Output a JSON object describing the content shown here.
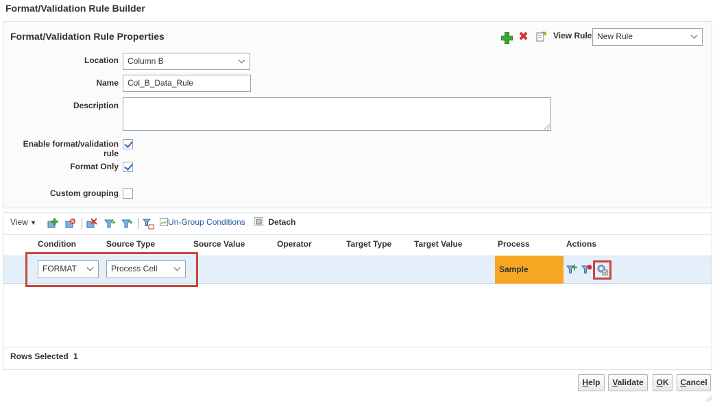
{
  "page": {
    "title": "Format/Validation Rule Builder"
  },
  "properties": {
    "title": "Format/Validation Rule Properties",
    "view_rule_label": "View Rule",
    "view_rule_value": "New Rule",
    "location_label": "Location",
    "location_value": "Column B",
    "name_label": "Name",
    "name_value": "Col_B_Data_Rule",
    "description_label": "Description",
    "description_value": "",
    "enable_label": "Enable format/validation rule",
    "enable_checked": true,
    "format_only_label": "Format Only",
    "format_only_checked": true,
    "custom_grouping_label": "Custom grouping",
    "custom_grouping_checked": false
  },
  "toolbar": {
    "view_label": "View",
    "ungroup_label": "Un-Group Conditions",
    "detach_label": "Detach"
  },
  "table": {
    "headers": [
      "Condition",
      "Source Type",
      "Source Value",
      "Operator",
      "Target Type",
      "Target Value",
      "Process",
      "Actions"
    ],
    "rows": [
      {
        "condition": "FORMAT",
        "source_type": "Process Cell",
        "process": "Sample"
      }
    ],
    "footer_label": "Rows Selected",
    "footer_count": "1"
  },
  "buttons": {
    "help": {
      "pre": "",
      "key": "H",
      "post": "elp"
    },
    "validate": {
      "pre": "",
      "key": "V",
      "post": "alidate"
    },
    "ok": {
      "pre": "",
      "key": "O",
      "post": "K"
    },
    "cancel": {
      "pre": "",
      "key": "C",
      "post": "ancel"
    }
  },
  "colors": {
    "process_highlight": "#f5a623",
    "annotation_box": "#c4463a",
    "selected_row": "#e4effa"
  }
}
